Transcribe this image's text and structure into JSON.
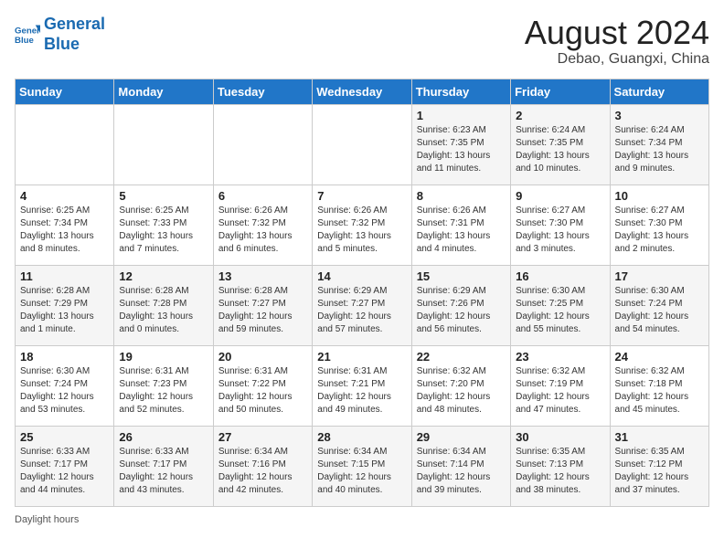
{
  "header": {
    "logo_line1": "General",
    "logo_line2": "Blue",
    "month_year": "August 2024",
    "location": "Debao, Guangxi, China"
  },
  "days_of_week": [
    "Sunday",
    "Monday",
    "Tuesday",
    "Wednesday",
    "Thursday",
    "Friday",
    "Saturday"
  ],
  "weeks": [
    [
      {
        "day": "",
        "info": ""
      },
      {
        "day": "",
        "info": ""
      },
      {
        "day": "",
        "info": ""
      },
      {
        "day": "",
        "info": ""
      },
      {
        "day": "1",
        "info": "Sunrise: 6:23 AM\nSunset: 7:35 PM\nDaylight: 13 hours and 11 minutes."
      },
      {
        "day": "2",
        "info": "Sunrise: 6:24 AM\nSunset: 7:35 PM\nDaylight: 13 hours and 10 minutes."
      },
      {
        "day": "3",
        "info": "Sunrise: 6:24 AM\nSunset: 7:34 PM\nDaylight: 13 hours and 9 minutes."
      }
    ],
    [
      {
        "day": "4",
        "info": "Sunrise: 6:25 AM\nSunset: 7:34 PM\nDaylight: 13 hours and 8 minutes."
      },
      {
        "day": "5",
        "info": "Sunrise: 6:25 AM\nSunset: 7:33 PM\nDaylight: 13 hours and 7 minutes."
      },
      {
        "day": "6",
        "info": "Sunrise: 6:26 AM\nSunset: 7:32 PM\nDaylight: 13 hours and 6 minutes."
      },
      {
        "day": "7",
        "info": "Sunrise: 6:26 AM\nSunset: 7:32 PM\nDaylight: 13 hours and 5 minutes."
      },
      {
        "day": "8",
        "info": "Sunrise: 6:26 AM\nSunset: 7:31 PM\nDaylight: 13 hours and 4 minutes."
      },
      {
        "day": "9",
        "info": "Sunrise: 6:27 AM\nSunset: 7:30 PM\nDaylight: 13 hours and 3 minutes."
      },
      {
        "day": "10",
        "info": "Sunrise: 6:27 AM\nSunset: 7:30 PM\nDaylight: 13 hours and 2 minutes."
      }
    ],
    [
      {
        "day": "11",
        "info": "Sunrise: 6:28 AM\nSunset: 7:29 PM\nDaylight: 13 hours and 1 minute."
      },
      {
        "day": "12",
        "info": "Sunrise: 6:28 AM\nSunset: 7:28 PM\nDaylight: 13 hours and 0 minutes."
      },
      {
        "day": "13",
        "info": "Sunrise: 6:28 AM\nSunset: 7:27 PM\nDaylight: 12 hours and 59 minutes."
      },
      {
        "day": "14",
        "info": "Sunrise: 6:29 AM\nSunset: 7:27 PM\nDaylight: 12 hours and 57 minutes."
      },
      {
        "day": "15",
        "info": "Sunrise: 6:29 AM\nSunset: 7:26 PM\nDaylight: 12 hours and 56 minutes."
      },
      {
        "day": "16",
        "info": "Sunrise: 6:30 AM\nSunset: 7:25 PM\nDaylight: 12 hours and 55 minutes."
      },
      {
        "day": "17",
        "info": "Sunrise: 6:30 AM\nSunset: 7:24 PM\nDaylight: 12 hours and 54 minutes."
      }
    ],
    [
      {
        "day": "18",
        "info": "Sunrise: 6:30 AM\nSunset: 7:24 PM\nDaylight: 12 hours and 53 minutes."
      },
      {
        "day": "19",
        "info": "Sunrise: 6:31 AM\nSunset: 7:23 PM\nDaylight: 12 hours and 52 minutes."
      },
      {
        "day": "20",
        "info": "Sunrise: 6:31 AM\nSunset: 7:22 PM\nDaylight: 12 hours and 50 minutes."
      },
      {
        "day": "21",
        "info": "Sunrise: 6:31 AM\nSunset: 7:21 PM\nDaylight: 12 hours and 49 minutes."
      },
      {
        "day": "22",
        "info": "Sunrise: 6:32 AM\nSunset: 7:20 PM\nDaylight: 12 hours and 48 minutes."
      },
      {
        "day": "23",
        "info": "Sunrise: 6:32 AM\nSunset: 7:19 PM\nDaylight: 12 hours and 47 minutes."
      },
      {
        "day": "24",
        "info": "Sunrise: 6:32 AM\nSunset: 7:18 PM\nDaylight: 12 hours and 45 minutes."
      }
    ],
    [
      {
        "day": "25",
        "info": "Sunrise: 6:33 AM\nSunset: 7:17 PM\nDaylight: 12 hours and 44 minutes."
      },
      {
        "day": "26",
        "info": "Sunrise: 6:33 AM\nSunset: 7:17 PM\nDaylight: 12 hours and 43 minutes."
      },
      {
        "day": "27",
        "info": "Sunrise: 6:34 AM\nSunset: 7:16 PM\nDaylight: 12 hours and 42 minutes."
      },
      {
        "day": "28",
        "info": "Sunrise: 6:34 AM\nSunset: 7:15 PM\nDaylight: 12 hours and 40 minutes."
      },
      {
        "day": "29",
        "info": "Sunrise: 6:34 AM\nSunset: 7:14 PM\nDaylight: 12 hours and 39 minutes."
      },
      {
        "day": "30",
        "info": "Sunrise: 6:35 AM\nSunset: 7:13 PM\nDaylight: 12 hours and 38 minutes."
      },
      {
        "day": "31",
        "info": "Sunrise: 6:35 AM\nSunset: 7:12 PM\nDaylight: 12 hours and 37 minutes."
      }
    ]
  ],
  "footer": {
    "daylight_label": "Daylight hours"
  }
}
